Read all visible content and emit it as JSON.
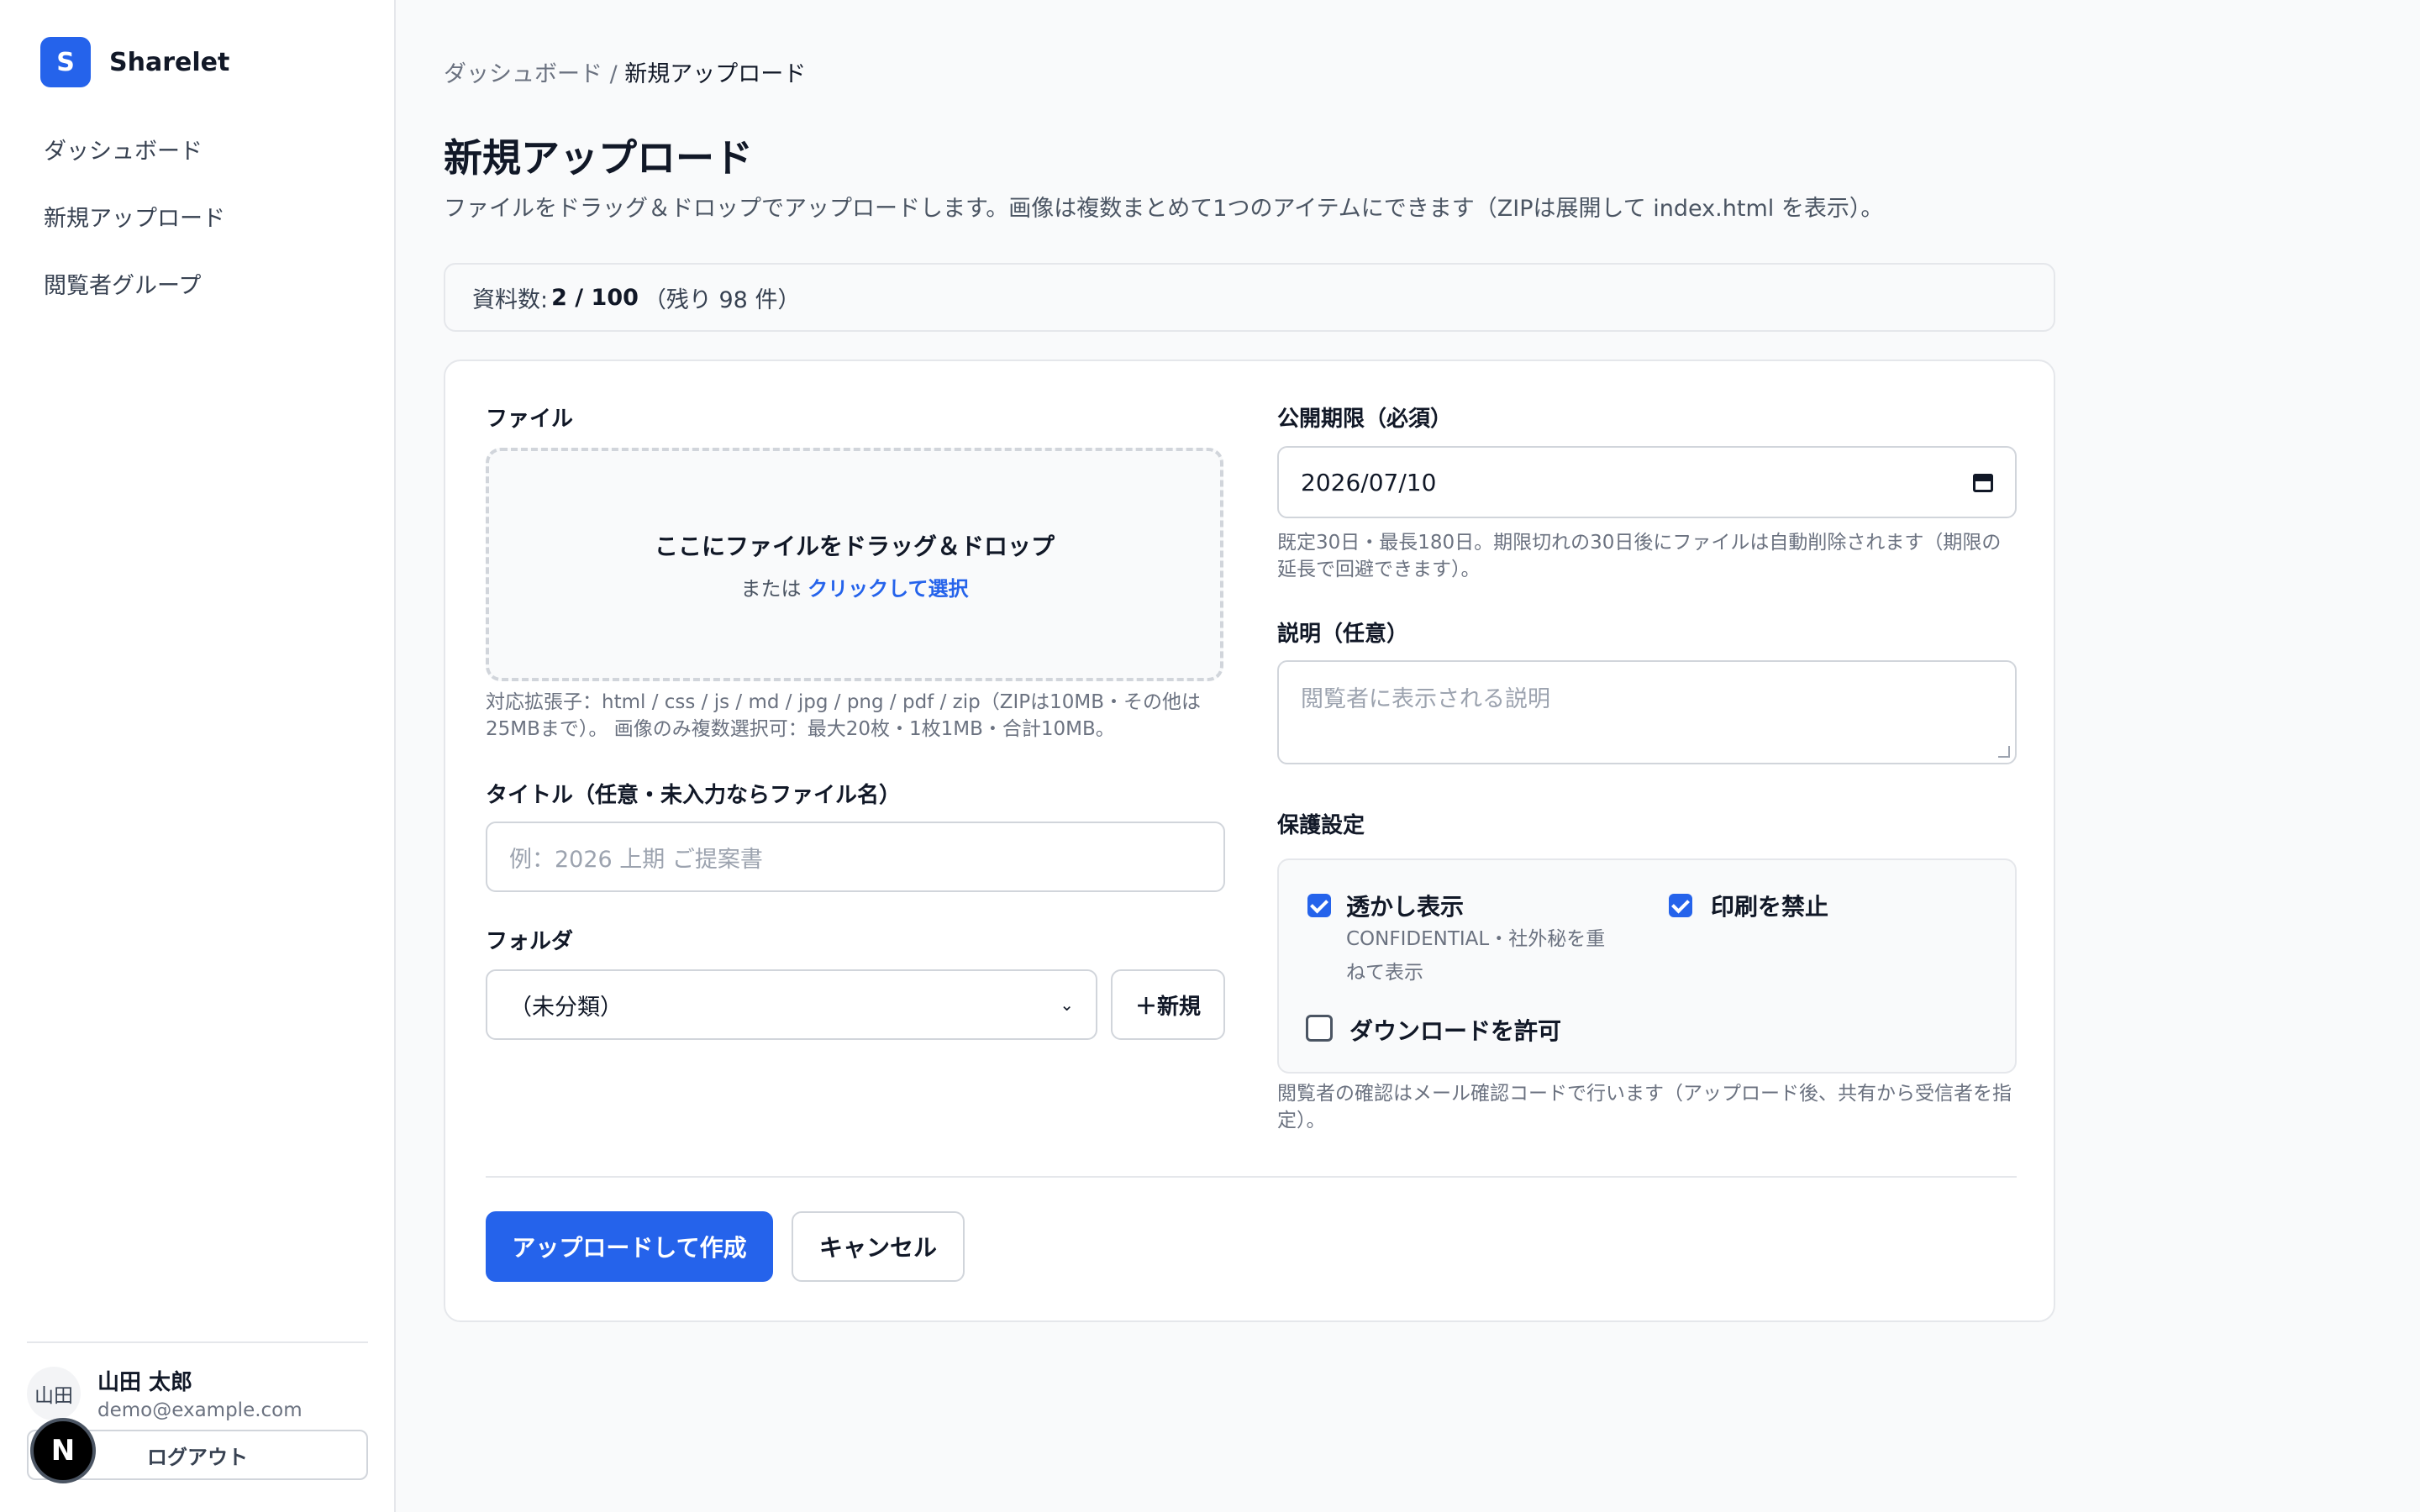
{
  "brand": {
    "logo_letter": "S",
    "name": "Sharelet"
  },
  "nav": {
    "items": [
      {
        "label": "ダッシュボード"
      },
      {
        "label": "新規アップロード"
      },
      {
        "label": "閲覧者グループ"
      }
    ]
  },
  "user": {
    "avatar_text": "山田",
    "name": "山田 太郎",
    "email": "demo@example.com",
    "logout_label": "ログアウト"
  },
  "nextjs_badge": "N",
  "breadcrumb": {
    "parent": "ダッシュボード",
    "separator": " / ",
    "current": "新規アップロード"
  },
  "page": {
    "title": "新規アップロード",
    "description": "ファイルをドラッグ＆ドロップでアップロードします。画像は複数まとめて1つのアイテムにできます（ZIPは展開して index.html を表示）。"
  },
  "quota": {
    "prefix": "資料数:",
    "value": "2 / 100",
    "suffix": "（残り 98 件）"
  },
  "form": {
    "file": {
      "label": "ファイル",
      "dropzone_title": "ここにファイルをドラッグ＆ドロップ",
      "dropzone_or": "または",
      "dropzone_link": "クリックして選択",
      "help": "対応拡張子：html / css / js / md / jpg / png / pdf / zip（ZIPは10MB・その他は25MBまで）。 画像のみ複数選択可：最大20枚・1枚1MB・合計10MB。"
    },
    "title": {
      "label": "タイトル（任意・未入力ならファイル名）",
      "placeholder": "例：2026 上期 ご提案書",
      "value": ""
    },
    "folder": {
      "label": "フォルダ",
      "selected": "（未分類）",
      "new_button": "＋新規"
    },
    "expiry": {
      "label": "公開期限（必須）",
      "value": "2026/07/10",
      "help": "既定30日・最長180日。期限切れの30日後にファイルは自動削除されます（期限の延長で回避できます）。"
    },
    "description": {
      "label": "説明（任意）",
      "placeholder": "閲覧者に表示される説明",
      "value": ""
    },
    "protection": {
      "label": "保護設定",
      "watermark": {
        "label": "透かし表示",
        "checked": true,
        "sub": "CONFIDENTIAL・社外秘を重ねて表示"
      },
      "no_print": {
        "label": "印刷を禁止",
        "checked": true
      },
      "allow_download": {
        "label": "ダウンロードを許可",
        "checked": false
      },
      "help": "閲覧者の確認はメール確認コードで行います（アップロード後、共有から受信者を指定）。"
    },
    "submit_label": "アップロードして作成",
    "cancel_label": "キャンセル"
  },
  "colors": {
    "accent": "#2563eb",
    "border": "#e5e7eb",
    "muted": "#6b7280"
  }
}
